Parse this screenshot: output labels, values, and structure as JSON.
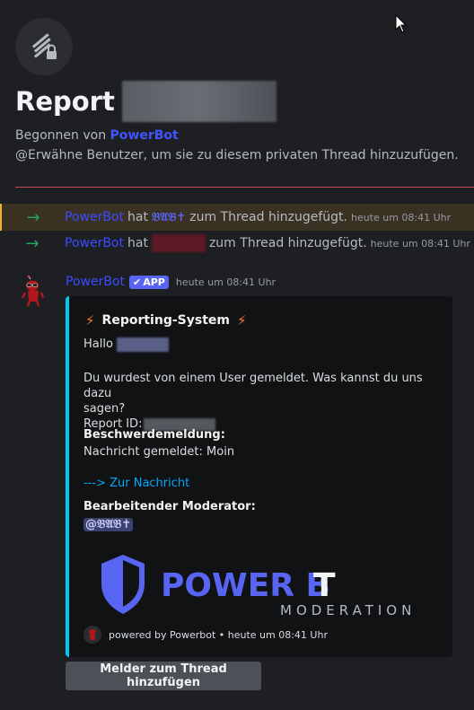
{
  "thread": {
    "title": "Report",
    "started_by_prefix": "Begonnen von ",
    "started_by_user": "PowerBot",
    "mention_hint": "@Erwähne Benutzer, um sie zu diesem privaten Thread hinzuzufügen."
  },
  "system_messages": [
    {
      "actor": "PowerBot",
      "verb": "hat",
      "target": "𝔅𝔄𝔅✝",
      "action": "zum Thread hinzugefügt.",
      "timestamp": "heute um 08:41 Uhr",
      "highlighted": true
    },
    {
      "actor": "PowerBot",
      "verb": "hat",
      "target": "",
      "action": "zum Thread hinzugefügt.",
      "timestamp": "heute um 08:41 Uhr",
      "highlighted": false
    }
  ],
  "message": {
    "author": "PowerBot",
    "app_tag": "APP",
    "timestamp": "heute um 08:41 Uhr",
    "embed": {
      "accent_color": "#00c8f0",
      "title": "Reporting-System",
      "greeting": "Hallo",
      "body_line1": "Du wurdest von einem User gemeldet. Was kannst du uns dazu",
      "body_line2": "sagen?",
      "report_id_label": "Report ID:",
      "complaint_heading": "Beschwerdemeldung:",
      "complaint_text": "Nachricht gemeldet: Moin",
      "link_text": "---> Zur Nachricht",
      "moderator_heading": "Bearbeitender Moderator:",
      "moderator_mention": "@𝔅𝔄𝔅✝",
      "banner_text_power": "POWER B",
      "banner_text_t": "T",
      "banner_subtitle": "MODERATION",
      "footer_text": "powered by Powerbot • heute um 08:41 Uhr"
    },
    "button_label": "Melder zum Thread hinzufügen"
  },
  "colors": {
    "brand_blue": "#4054ff",
    "embed_accent": "#00c8f0",
    "highlight_border": "#f0b232",
    "join_arrow": "#23a55a"
  },
  "icons": {
    "thread_icon": "thread-lock-icon",
    "arrow": "join-arrow-icon",
    "bolt": "lightning-icon",
    "check": "verified-check-icon"
  }
}
